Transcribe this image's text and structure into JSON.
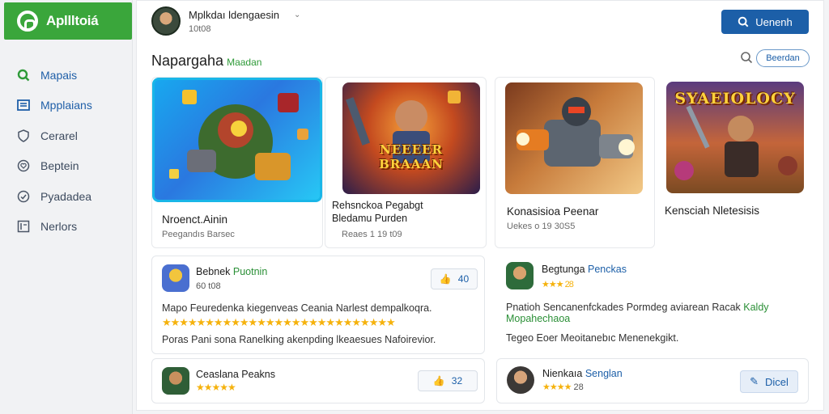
{
  "app": {
    "title": "Apllltoiá"
  },
  "sidebar": {
    "items": [
      {
        "label": "Mapais",
        "icon": "search-icon"
      },
      {
        "label": "Mpplaians",
        "icon": "grid-icon"
      },
      {
        "label": "Cerarel",
        "icon": "shield-icon"
      },
      {
        "label": "Beptein",
        "icon": "heart-icon"
      },
      {
        "label": "Pyadadea",
        "icon": "check-circle-icon"
      },
      {
        "label": "Nerlors",
        "icon": "news-icon"
      }
    ]
  },
  "header": {
    "user_name": "Mplkdaı ldengaesin",
    "user_sub": "10t08",
    "search_label": "Uenenh"
  },
  "section": {
    "title": "Napargaha",
    "accent": "Maadan",
    "filter_label": "Beerdan"
  },
  "games": [
    {
      "title": "Nroenct.Ainin",
      "sub": "Peegandıs Barsec",
      "art": ""
    },
    {
      "title": "Rehsnckoa Pegabgt\nBledamu Purden",
      "sub": "Reaes 1 19 t09",
      "art": "NEEEER\nBRAAAN"
    },
    {
      "title": "Konasisioa Peenar",
      "sub": "Uekes o 19 30S5",
      "art": ""
    },
    {
      "title": "Kensciah Nletesisis",
      "sub": "",
      "art": "SYAEIOLOCY"
    }
  ],
  "reviews": [
    {
      "name": "Bebnek",
      "tag": "Puotnin",
      "meta": "60 t08",
      "text": "Mapo Feuredenka kiegenveas Ceania Narlest dempalkoqra.",
      "stars": "★★★★★★★★★★★★★★★★★★★★★★★★★★★",
      "text2": "Poras Pani sona Ranelking akenpding lkeaesues Nafoirevior.",
      "like": "40"
    },
    {
      "name": "Begtunga",
      "tag": "Penckas",
      "meta": "★★★ 28",
      "text": "Pnatioh Sencanenfckades Pormdeg aviarean Racak",
      "text_tag": "Kaldy Mopahechaoa",
      "text2": "Tegeo Eoer Meoitanebıc Menenekgikt."
    },
    {
      "name": "Ceaslana Peakns",
      "stars": "★★★★★",
      "like": "32"
    },
    {
      "name": "Nienkaıa",
      "tag": "Senglan",
      "stars": "★★★★",
      "meta": "28",
      "edit": "Dicel"
    }
  ],
  "colors": {
    "brand": "#3aa63b",
    "primary": "#1c5fa8",
    "star": "#f5b20d"
  }
}
